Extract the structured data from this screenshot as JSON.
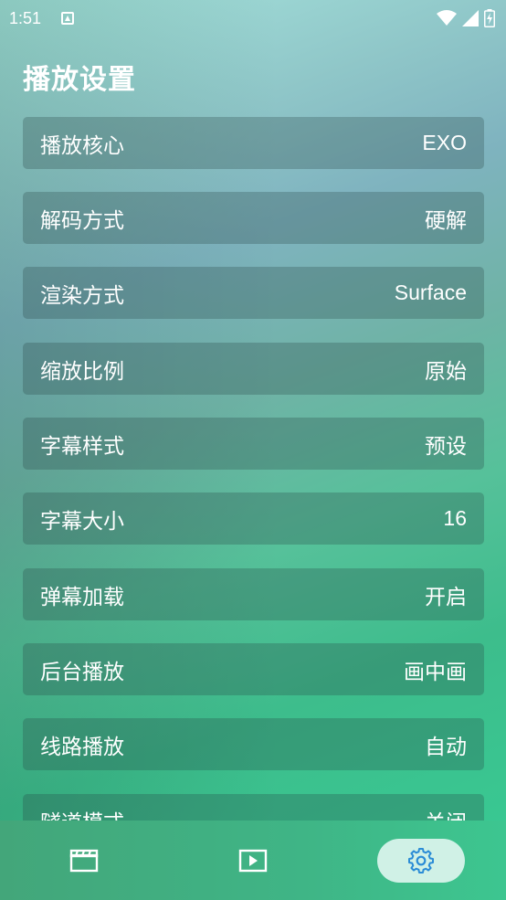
{
  "status_bar": {
    "time": "1:51"
  },
  "page": {
    "title": "播放设置"
  },
  "settings": [
    {
      "label": "播放核心",
      "value": "EXO"
    },
    {
      "label": "解码方式",
      "value": "硬解"
    },
    {
      "label": "渲染方式",
      "value": "Surface"
    },
    {
      "label": "缩放比例",
      "value": "原始"
    },
    {
      "label": "字幕样式",
      "value": "预设"
    },
    {
      "label": "字幕大小",
      "value": "16"
    },
    {
      "label": "弹幕加载",
      "value": "开启"
    },
    {
      "label": "后台播放",
      "value": "画中画"
    },
    {
      "label": "线路播放",
      "value": "自动"
    },
    {
      "label": "隧道模式",
      "value": "关闭"
    }
  ],
  "bottom_nav": {
    "items": [
      {
        "icon": "clapperboard-icon",
        "active": false
      },
      {
        "icon": "play-icon",
        "active": false
      },
      {
        "icon": "gear-icon",
        "active": true
      }
    ],
    "active_color": "#2b8cd6"
  }
}
